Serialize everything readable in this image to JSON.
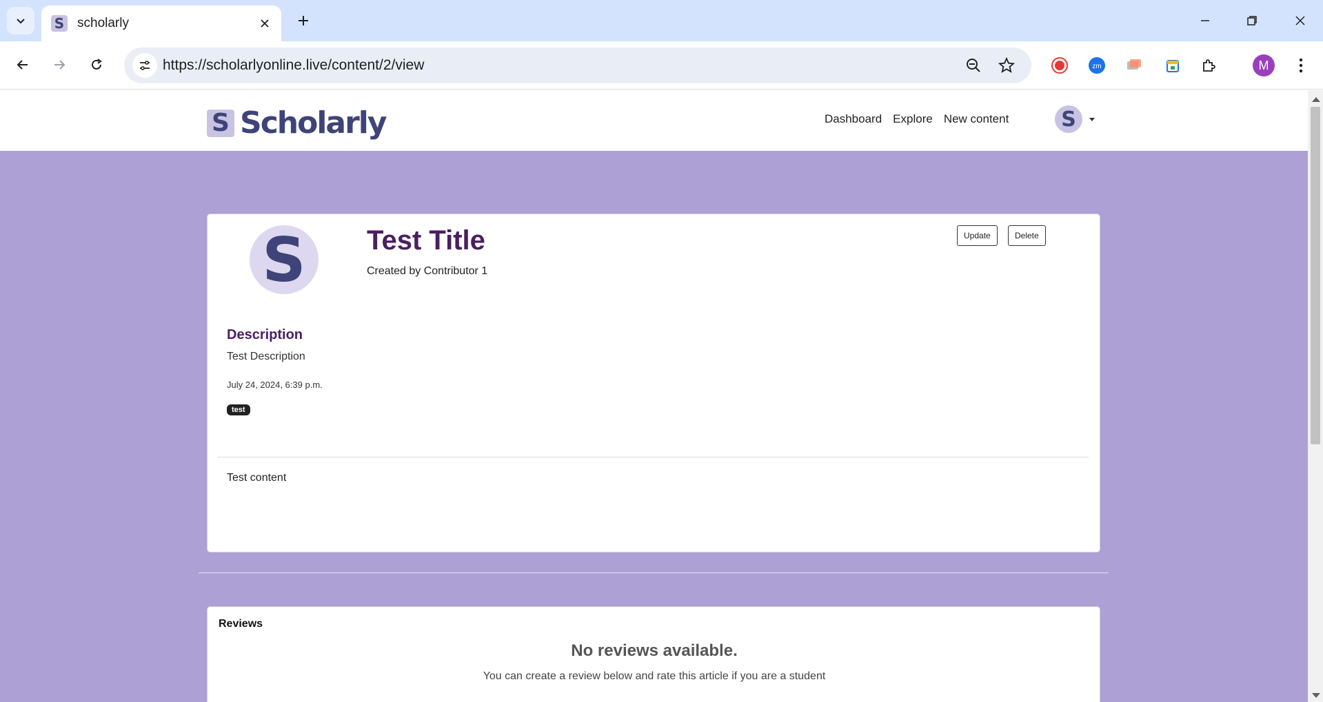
{
  "browser": {
    "tab_title": "scholarly",
    "favicon_letter": "S",
    "url": "https://scholarlyonline.live/content/2/view",
    "profile_initial": "M"
  },
  "site": {
    "logo_letter": "S",
    "logo_text": "Scholarly",
    "nav": [
      "Dashboard",
      "Explore",
      "New content"
    ],
    "avatar_letter": "S"
  },
  "content": {
    "avatar_letter": "S",
    "title": "Test Title",
    "created_by": "Created by Contributor 1",
    "update_label": "Update",
    "delete_label": "Delete",
    "description_heading": "Description",
    "description": "Test Description",
    "date": "July 24, 2024, 6:39 p.m.",
    "tags": [
      "test"
    ],
    "body": "Test content"
  },
  "reviews": {
    "heading": "Reviews",
    "empty_title": "No reviews available.",
    "empty_subtitle": "You can create a review below and rate this article if you are a student"
  },
  "colors": {
    "page_background": "#aca0d4",
    "brand": "#3e4479",
    "title": "#4a1f5f"
  }
}
